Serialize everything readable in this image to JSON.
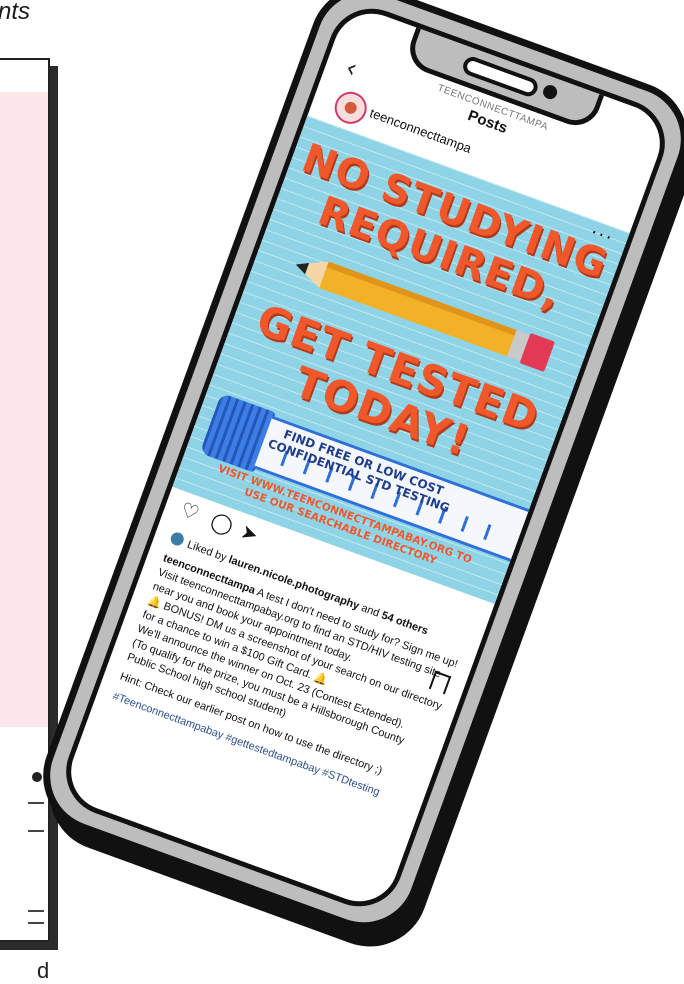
{
  "background": {
    "heading_fragment": "nts",
    "bottom_fragment": "d"
  },
  "header": {
    "account": "TEENCONNECTTAMPA",
    "title": "Posts",
    "back_icon": "chevron-left-icon",
    "more_icon": "more-horizontal-icon"
  },
  "post": {
    "username": "teenconnecttampa",
    "image": {
      "line1": "NO STUDYING",
      "line2": "REQUIRED,",
      "line3": "GET TESTED",
      "line4": "TODAY!",
      "find_line1": "FIND FREE OR LOW COST",
      "find_line2": "CONFIDENTIAL STD TESTING",
      "visit_line1": "VISIT WWW.TEENCONNECTTAMPABAY.ORG TO",
      "visit_line2": "USE OUR SEARCHABLE DIRECTORY",
      "colors": {
        "background": "#8fd3e6",
        "headline": "#f0572b",
        "tube": "#2f6fd9"
      }
    },
    "actions": {
      "like_icon": "heart-icon",
      "comment_icon": "comment-icon",
      "share_icon": "send-icon",
      "save_icon": "bookmark-icon"
    },
    "likes": {
      "prefix": "Liked by",
      "user": "lauren.nicole.photography",
      "and": "and",
      "others": "54 others"
    },
    "caption": {
      "user": "teenconnecttampa",
      "line1": "A test I don't need to study for? Sign me up! Visit teenconnecttampabay.org to find an STD/HIV testing site near you and book your appointment today.",
      "line2": "🔔 BONUS! DM us a screenshot of your search on our directory for a chance to win a $100 Gift Card. 🔔",
      "line3": "We'll announce the winner on Oct. 23 (Contest Extended).",
      "line4": "(To qualify for the prize, you must be a Hillsborough County Public School high school student)",
      "hint": "Hint: Check our earlier post on how to use the directory ;)",
      "hashtags": "#Teenconnecttampabay #gettestedtampabay #STDtesting"
    }
  }
}
